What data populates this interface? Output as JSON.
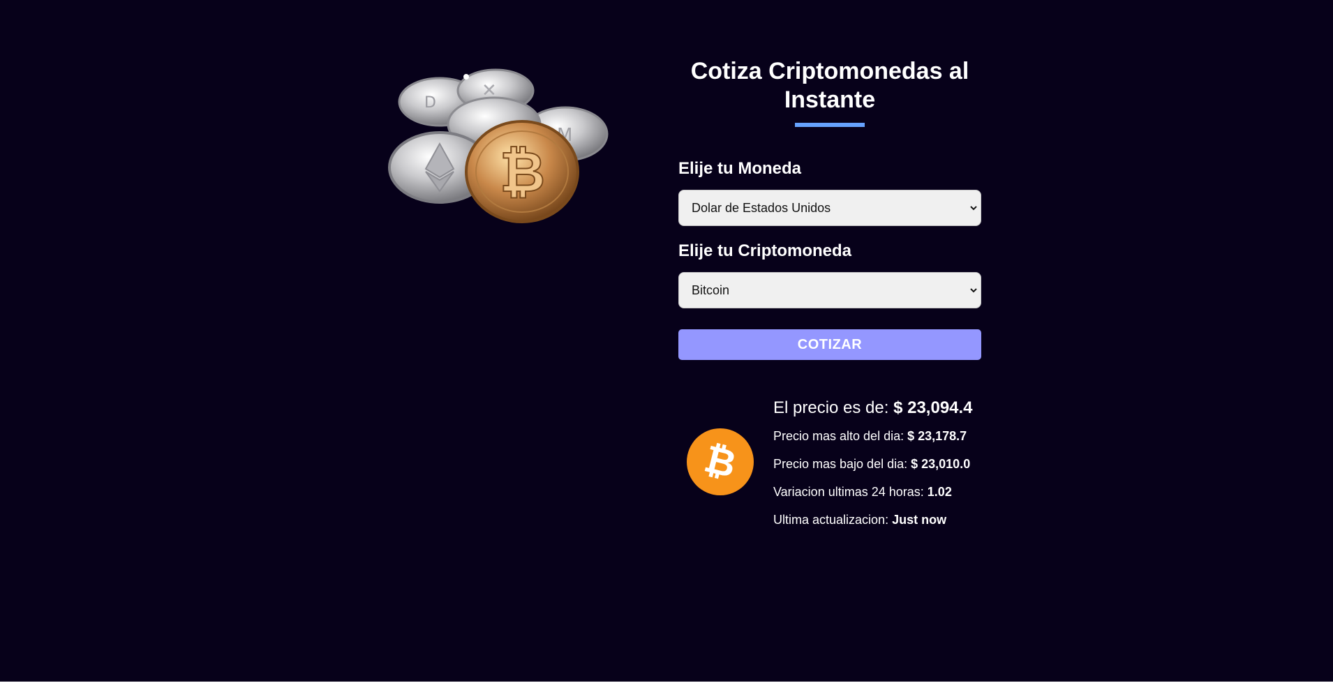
{
  "header": {
    "title": "Cotiza Criptomonedas al Instante"
  },
  "image": {
    "icon": "crypto-coins-image"
  },
  "form": {
    "currency_label": "Elije tu Moneda",
    "currency_selected": "Dolar de Estados Unidos",
    "crypto_label": "Elije tu Criptomoneda",
    "crypto_selected": "Bitcoin",
    "submit_label": "COTIZAR"
  },
  "result": {
    "coin_icon": "bitcoin-logo-icon",
    "price_label": "El precio es de:",
    "price_value": "$ 23,094.4",
    "high_label": "Precio mas alto del dia:",
    "high_value": "$ 23,178.7",
    "low_label": "Precio mas bajo del dia:",
    "low_value": "$ 23,010.0",
    "change_label": "Variacion ultimas 24 horas:",
    "change_value": "1.02",
    "updated_label": "Ultima actualizacion:",
    "updated_value": "Just now"
  },
  "colors": {
    "background": "#07011a",
    "accent_underline": "#66a2fe",
    "button": "#9497ff",
    "bitcoin_orange": "#f7931a"
  }
}
